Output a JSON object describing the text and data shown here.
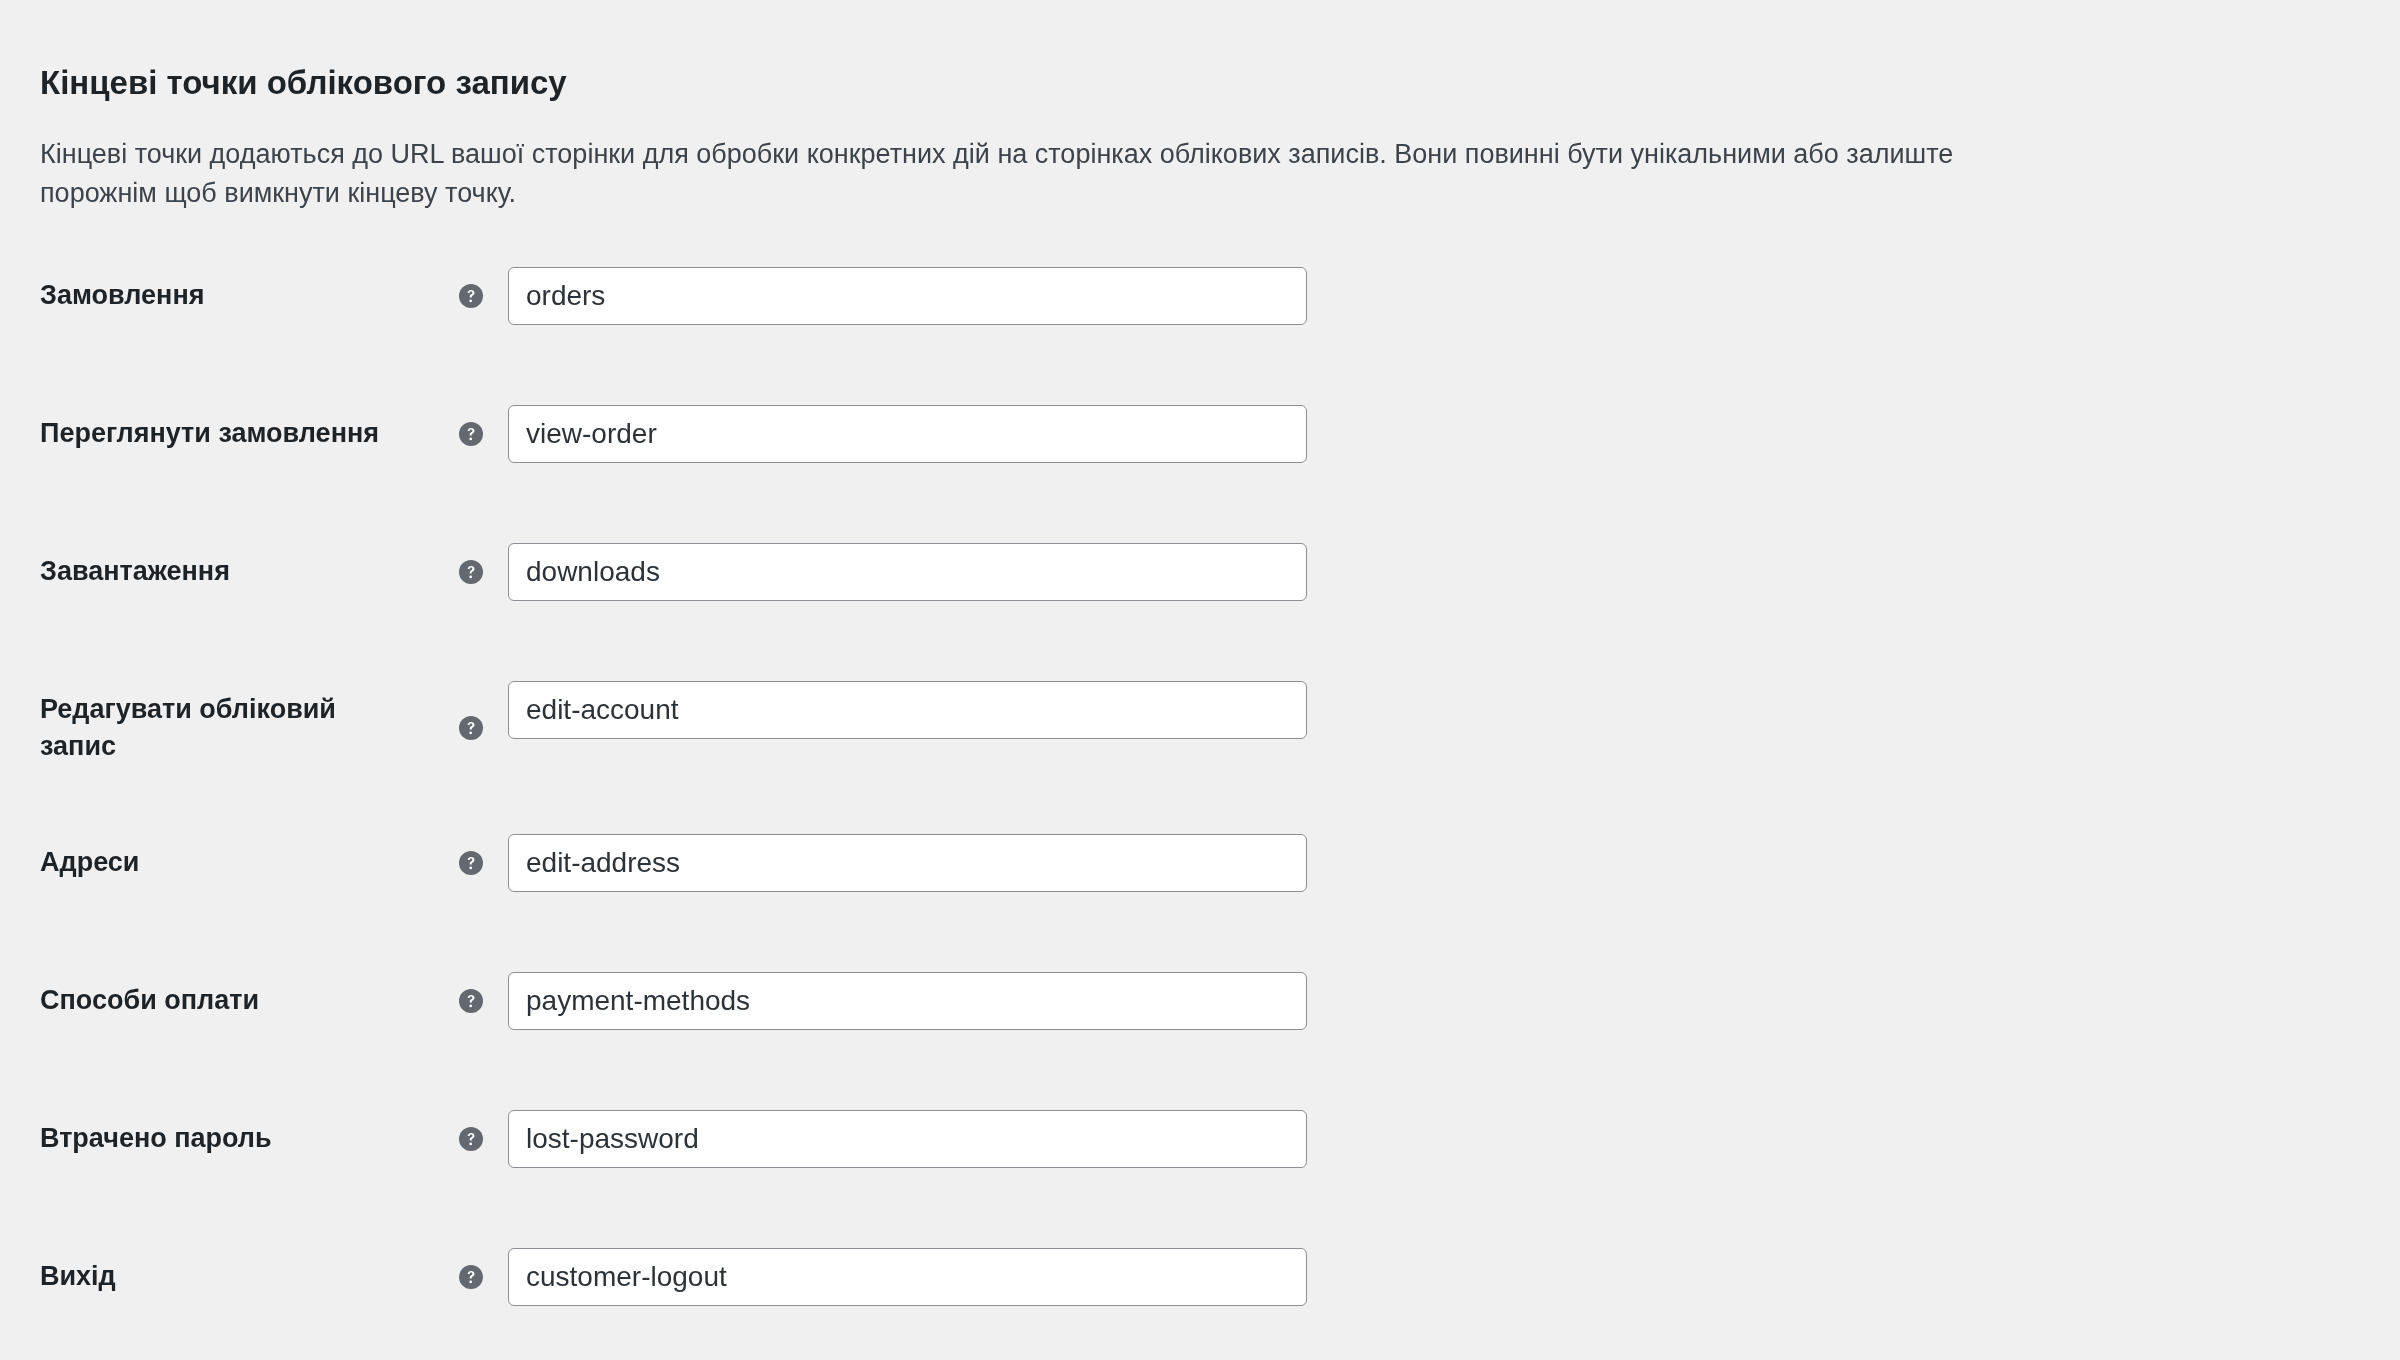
{
  "section": {
    "title": "Кінцеві точки облікового запису",
    "description": "Кінцеві точки додаються до URL вашої сторінки для обробки конкретних дій на сторінках облікових записів. Вони повинні бути унікальними або залиште порожнім щоб вимкнути кінцеву точку."
  },
  "endpoints": [
    {
      "label": "Замовлення",
      "value": "orders"
    },
    {
      "label": "Переглянути замовлення",
      "value": "view-order"
    },
    {
      "label": "Завантаження",
      "value": "downloads"
    },
    {
      "label": "Редагувати обліковий запис",
      "value": "edit-account"
    },
    {
      "label": "Адреси",
      "value": "edit-address"
    },
    {
      "label": "Способи оплати",
      "value": "payment-methods"
    },
    {
      "label": "Втрачено пароль",
      "value": "lost-password"
    },
    {
      "label": "Вихід",
      "value": "customer-logout"
    }
  ]
}
